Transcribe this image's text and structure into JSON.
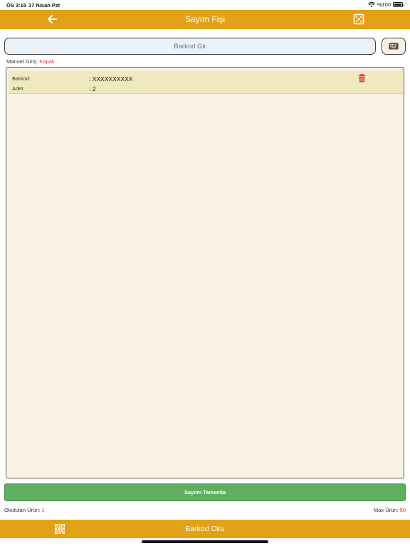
{
  "status_bar": {
    "time": "ÖS 3:15",
    "date": "17 Nisan Pzt",
    "battery": "%100"
  },
  "header": {
    "title": "Sayım Fişi",
    "back_icon": "arrow-left-icon",
    "action_icon": "scan-frame-icon"
  },
  "barcode": {
    "placeholder": "Barkod Gir",
    "keyboard_icon": "keyboard-icon"
  },
  "manual_entry": {
    "label": "Manuel Giriş:",
    "value": "Kapalı"
  },
  "items": [
    {
      "barcode_label": "Barkod:",
      "barcode_value": ": XXXXXXXXXX",
      "quantity_label": "Adet",
      "quantity_value": ": 2",
      "delete_icon": "trash-icon"
    }
  ],
  "complete_button": "Sayımı Tamamla",
  "footer": {
    "scanned_label": "Okutulan Ürün:",
    "scanned_value": "1",
    "max_label": "Max Ürün:",
    "max_value": "50"
  },
  "bottom_bar": {
    "label": "Barkod Oku",
    "icon": "qr-code-icon"
  },
  "colors": {
    "accent": "#E3A117",
    "success": "#5FAE62",
    "danger": "#E53935",
    "panel": "#F8F1E4",
    "row_highlight": "#EFE9BC"
  }
}
